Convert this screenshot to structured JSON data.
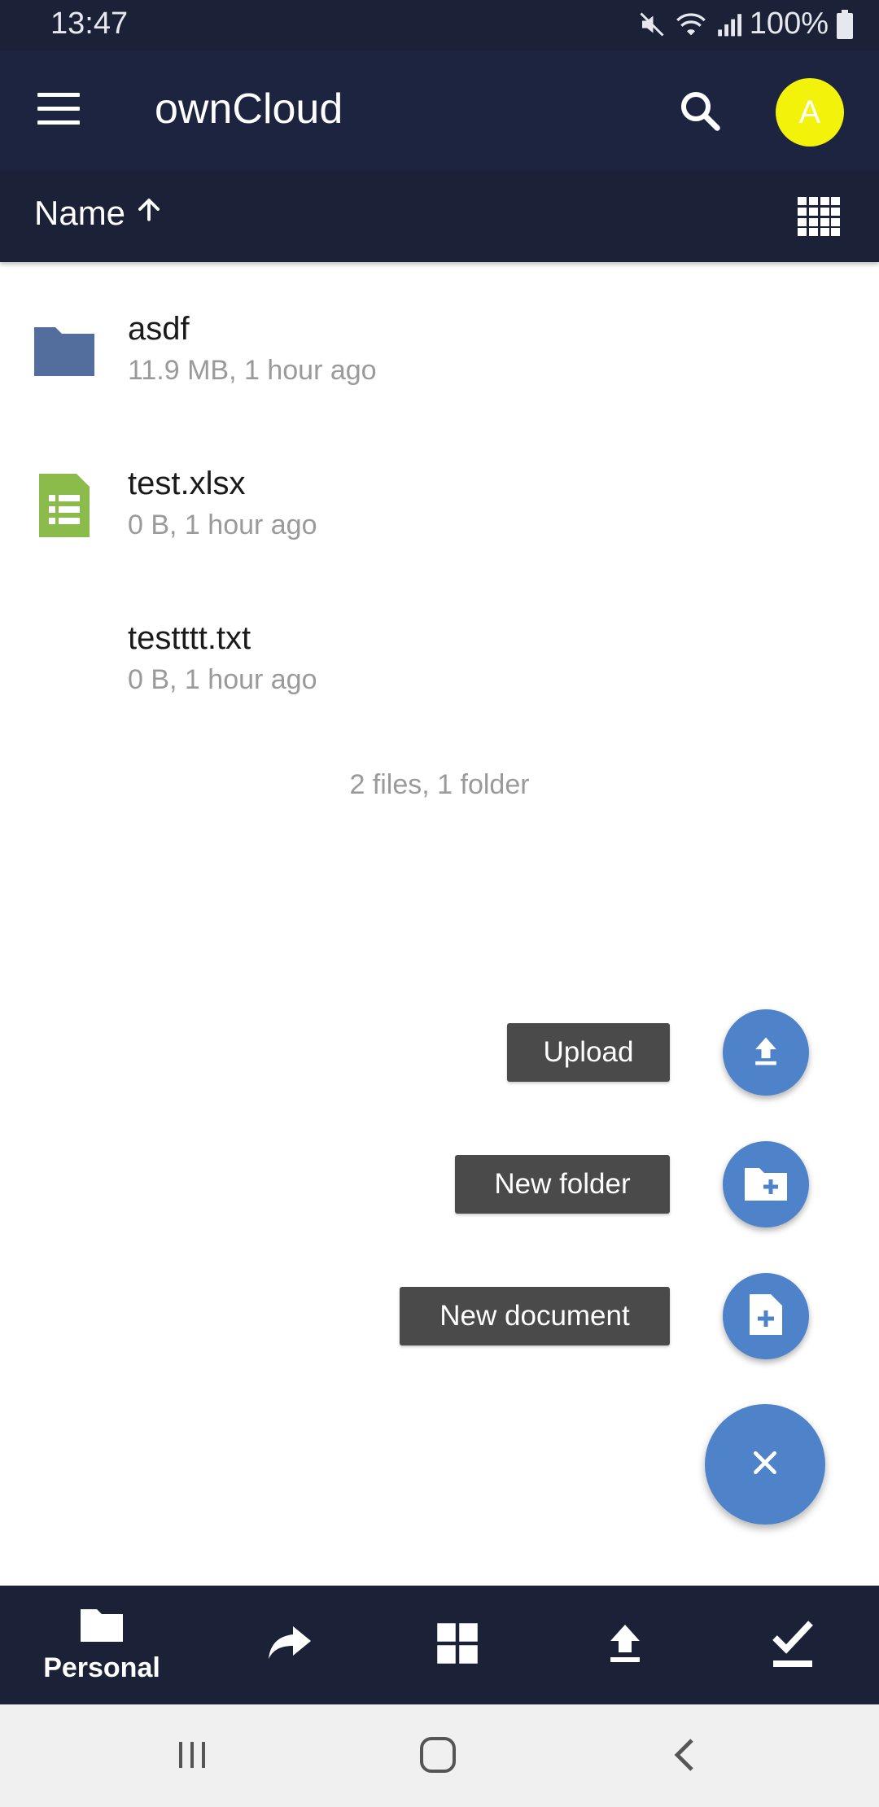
{
  "status_bar": {
    "time": "13:47",
    "battery": "100%"
  },
  "app_bar": {
    "title": "ownCloud",
    "avatar_initial": "A",
    "avatar_color": "#f2f20a"
  },
  "sort_bar": {
    "label": "Name"
  },
  "files": [
    {
      "name": "asdf",
      "meta": "11.9 MB, 1 hour ago",
      "icon": "folder-icon"
    },
    {
      "name": "test.xlsx",
      "meta": "0 B, 1 hour ago",
      "icon": "spreadsheet-icon"
    },
    {
      "name": "testttt.txt",
      "meta": "0 B, 1 hour ago",
      "icon": "none"
    }
  ],
  "summary": "2 files, 1 folder",
  "fab_menu": {
    "upload_label": "Upload",
    "new_folder_label": "New folder",
    "new_document_label": "New document"
  },
  "bottom_nav": {
    "personal_label": "Personal"
  },
  "colors": {
    "header": "#1d2440",
    "accent": "#4e82c9",
    "folder": "#536e9c",
    "spreadsheet": "#8bbb4a"
  }
}
